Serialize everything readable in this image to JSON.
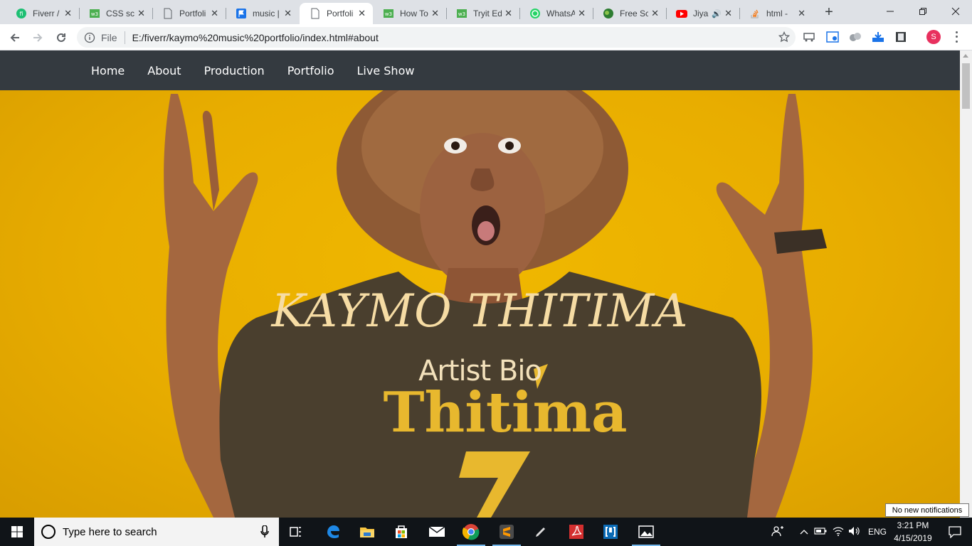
{
  "browser": {
    "tabs": [
      {
        "title": "Fiverr /",
        "icon": "fiverr-icon"
      },
      {
        "title": "CSS scr",
        "icon": "w3schools-icon"
      },
      {
        "title": "Portfoli",
        "icon": "page-icon"
      },
      {
        "title": "music |",
        "icon": "flag-icon"
      },
      {
        "title": "Portfoli",
        "icon": "page-icon",
        "active": true
      },
      {
        "title": "How To",
        "icon": "w3schools-icon"
      },
      {
        "title": "Tryit Ed",
        "icon": "w3schools-icon"
      },
      {
        "title": "WhatsA",
        "icon": "whatsapp-icon"
      },
      {
        "title": "Free Sc",
        "icon": "globe-icon"
      },
      {
        "title": "Jiya",
        "icon": "youtube-icon"
      },
      {
        "title": "html - ",
        "icon": "stackoverflow-icon"
      }
    ],
    "address": {
      "scheme_label": "File",
      "url": "E:/fiverr/kaymo%20music%20portfolio/index.html#about"
    },
    "profile_initial": "S"
  },
  "site": {
    "nav": [
      "Home",
      "About",
      "Production",
      "Portfolio",
      "Live Show"
    ],
    "hero": {
      "title": "KAYMO THITIMA",
      "subtitle": "Artist Bio",
      "shirt_text": "Thitima"
    }
  },
  "taskbar": {
    "search_placeholder": "Type here to search",
    "language": "ENG",
    "time": "3:21 PM",
    "date": "4/15/2019",
    "notification_tooltip": "No new notifications"
  },
  "colors": {
    "nav_bg": "#343a40",
    "hero_bg": "#eab000",
    "title_color": "#f6dca4"
  }
}
